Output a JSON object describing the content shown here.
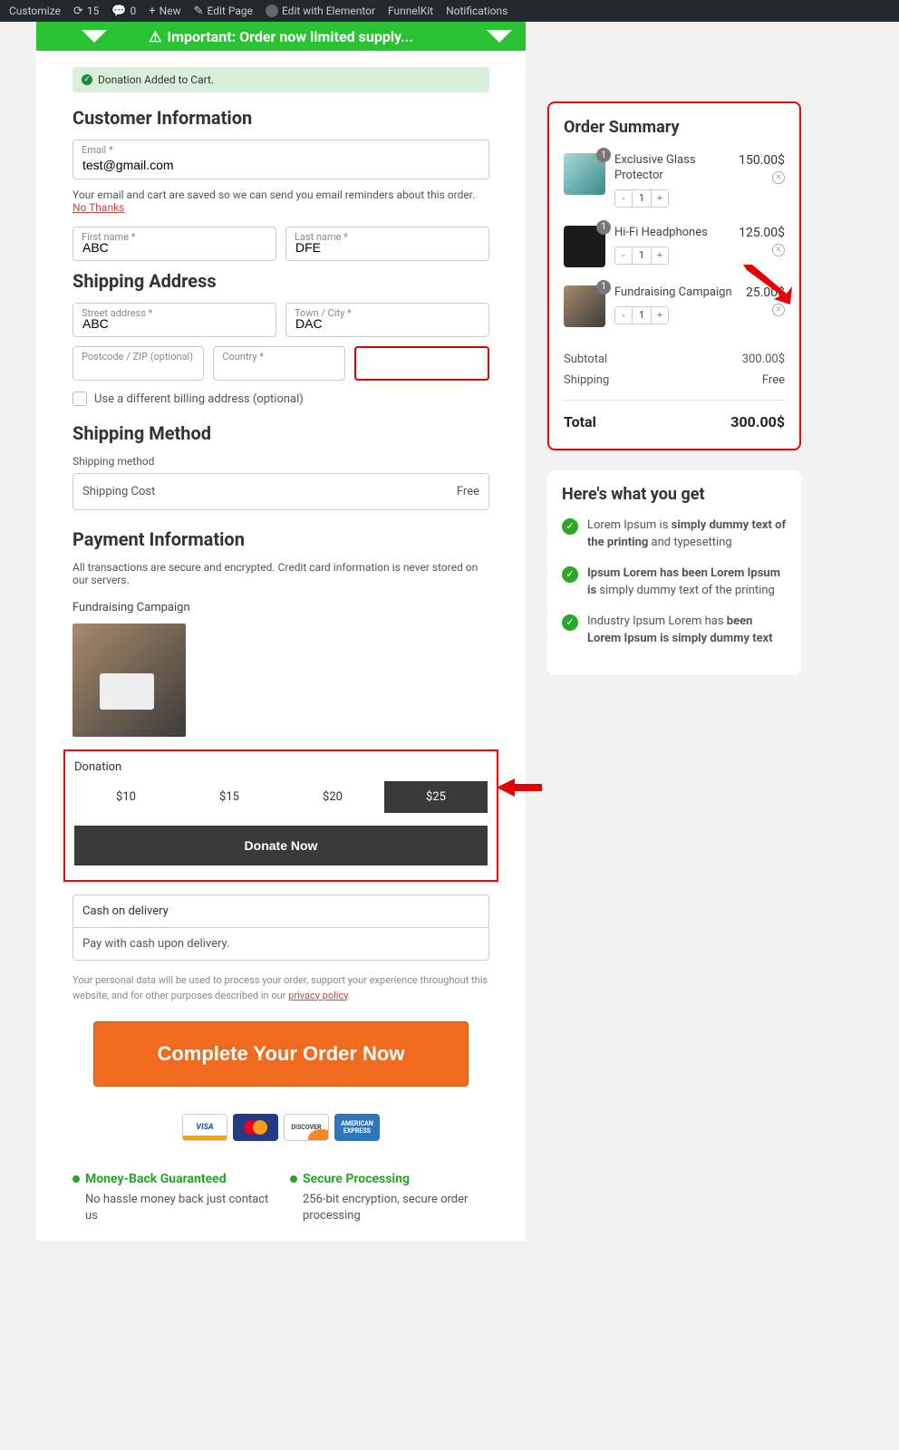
{
  "adminbar": {
    "customize": "Customize",
    "updates": "15",
    "comments": "0",
    "new": "New",
    "edit_page": "Edit Page",
    "edit_elementor": "Edit with Elementor",
    "funnelkit": "FunnelKit",
    "notifications": "Notifications"
  },
  "banner": "Important: Order now limited supply...",
  "notice": "Donation Added to Cart.",
  "sections": {
    "customer": "Customer Information",
    "shipping_addr": "Shipping Address",
    "shipping_method": "Shipping Method",
    "payment": "Payment Information"
  },
  "fields": {
    "email_label": "Email *",
    "email_value": "test@gmail.com",
    "fname_label": "First name *",
    "fname_value": "ABC",
    "lname_label": "Last name *",
    "lname_value": "DFE",
    "street_label": "Street address *",
    "street_value": "ABC",
    "town_label": "Town / City *",
    "town_value": "DAC",
    "postcode_label": "Postcode / ZIP (optional)",
    "country_label": "Country *"
  },
  "helper_text": "Your email and cart are saved so we can send you email reminders about this order.",
  "helper_link": "No Thanks",
  "diff_billing": "Use a different billing address (optional)",
  "shipping_method_label": "Shipping method",
  "shipping_cost": "Shipping Cost",
  "shipping_free": "Free",
  "payment_sub": "All transactions are secure and encrypted. Credit card information is never stored on our servers.",
  "campaign_title": "Fundraising Campaign",
  "donation": {
    "label": "Donation",
    "opts": [
      "$10",
      "$15",
      "$20",
      "$25"
    ],
    "selected": 3,
    "btn": "Donate Now"
  },
  "cod": {
    "head": "Cash on delivery",
    "body": "Pay with cash upon delivery."
  },
  "privacy_text": "Your personal data will be used to process your order, support your experience throughout this website, and for other purposes described in our ",
  "privacy_link": "privacy policy",
  "complete_btn": "Complete Your Order Now",
  "cards": {
    "visa": "VISA",
    "mc": "MasterCard",
    "disc": "DISCOVER",
    "amex": "AMERICAN EXPRESS"
  },
  "guarantees": [
    {
      "title": "Money-Back Guaranteed",
      "text": "No hassle money back just contact us"
    },
    {
      "title": "Secure Processing",
      "text": "256-bit encryption, secure order processing"
    }
  ],
  "summary": {
    "title": "Order Summary",
    "items": [
      {
        "name": "Exclusive Glass Protector",
        "price": "150.00$",
        "qty": "1"
      },
      {
        "name": "Hi-Fi Headphones",
        "price": "125.00$",
        "qty": "1"
      },
      {
        "name": "Fundraising Campaign",
        "price": "25.00$",
        "qty": "1"
      }
    ],
    "subtotal_label": "Subtotal",
    "subtotal": "300.00$",
    "shipping_label": "Shipping",
    "shipping": "Free",
    "total_label": "Total",
    "total": "300.00$"
  },
  "what_you_get": {
    "title": "Here's what you get",
    "items": [
      "Lorem Ipsum is <b>simply dummy text of the printing</b> and typesetting",
      "<b>Ipsum Lorem has been Lorem Ipsum is</b> simply dummy text of the printing",
      "Industry Ipsum Lorem has <b>been Lorem Ipsum is simply dummy text</b>"
    ]
  }
}
